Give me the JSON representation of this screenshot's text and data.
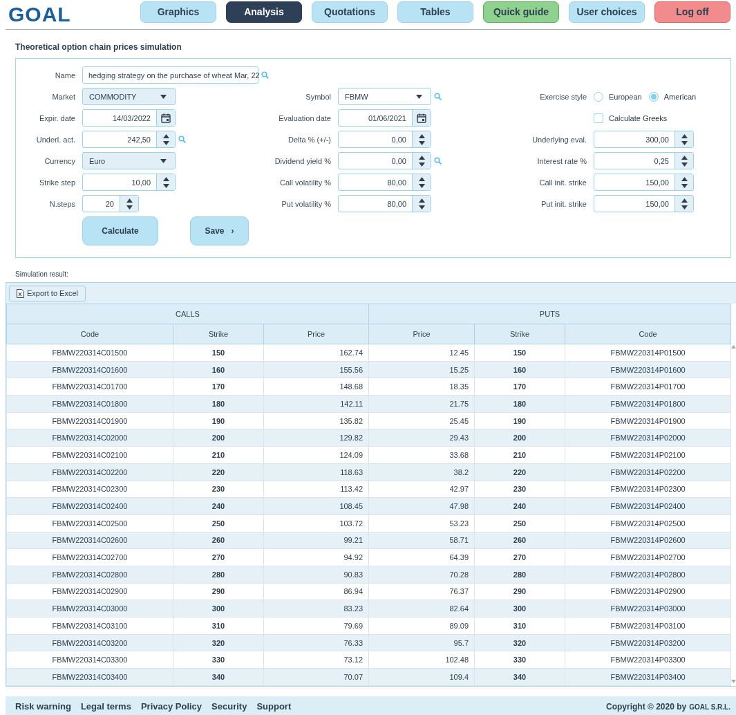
{
  "logo": "GOAL",
  "nav": [
    {
      "label": "Graphics",
      "kind": "nav",
      "selected": false
    },
    {
      "label": "Analysis",
      "kind": "nav",
      "selected": true
    },
    {
      "label": "Quotations",
      "kind": "nav",
      "selected": false
    },
    {
      "label": "Tables",
      "kind": "nav",
      "selected": false
    },
    {
      "label": "Quick guide",
      "kind": "guide",
      "selected": false
    },
    {
      "label": "User choices",
      "kind": "nav",
      "selected": false
    },
    {
      "label": "Log off",
      "kind": "logout",
      "selected": false
    }
  ],
  "page_title": "Theoretical option chain prices simulation",
  "form_rows": [
    {
      "left": {
        "label": "Name",
        "kind": "text",
        "value": "hedging strategy on the purchase of wheat Mar, 22",
        "search": true
      }
    },
    {
      "left": {
        "label": "Market",
        "kind": "select",
        "value": "COMMODITY"
      },
      "middle": {
        "label": "Symbol",
        "kind": "select",
        "value": "FBMW",
        "search": true
      },
      "right": {
        "label": "Exercise style",
        "kind": "radio",
        "options": [
          {
            "label": "European",
            "selected": false
          },
          {
            "label": "American",
            "selected": true
          }
        ]
      }
    },
    {
      "left": {
        "label": "Expir. date",
        "kind": "date",
        "value": "14/03/2022"
      },
      "middle": {
        "label": "Evaluation date",
        "kind": "date",
        "value": "01/06/2021"
      },
      "right": {
        "kind": "checkbox",
        "text": "Calculate Greeks",
        "checked": false
      }
    },
    {
      "left": {
        "label": "Underl. act.",
        "kind": "spin",
        "value": "242,50",
        "search": true
      },
      "middle": {
        "label": "Delta % (+/-)",
        "kind": "spin",
        "value": "0,00"
      },
      "right": {
        "label": "Underlying eval.",
        "kind": "spin",
        "value": "300,00"
      }
    },
    {
      "left": {
        "label": "Currency",
        "kind": "select",
        "value": "Euro"
      },
      "middle": {
        "label": "Dividend yield %",
        "kind": "spin",
        "value": "0,00",
        "search": true
      },
      "right": {
        "label": "Interest rate %",
        "kind": "spin",
        "value": "0,25"
      }
    },
    {
      "left": {
        "label": "Strike step",
        "kind": "spin",
        "value": "10,00"
      },
      "middle": {
        "label": "Call volatility %",
        "kind": "spin",
        "value": "80,00"
      },
      "right": {
        "label": "Call init. strike",
        "kind": "spin",
        "value": "150,00"
      }
    },
    {
      "left": {
        "label": "N.steps",
        "kind": "spin",
        "value": "20"
      },
      "middle": {
        "label": "Put volatility %",
        "kind": "spin",
        "value": "80,00"
      },
      "right": {
        "label": "Put init. strike",
        "kind": "spin",
        "value": "150,00"
      }
    }
  ],
  "actions": [
    {
      "label": "Calculate"
    },
    {
      "label": "Save",
      "suffix": "›"
    }
  ],
  "result_label": "Simulation result:",
  "export_button": "Export to Excel",
  "table": {
    "groups": [
      "CALLS",
      "PUTS"
    ],
    "columns": [
      "Code",
      "Strike",
      "Price",
      "Price",
      "Strike",
      "Code"
    ],
    "rows": [
      [
        "FBMW220314C01500",
        "150",
        "162.74",
        "12.45",
        "150",
        "FBMW220314P01500"
      ],
      [
        "FBMW220314C01600",
        "160",
        "155.56",
        "15.25",
        "160",
        "FBMW220314P01600"
      ],
      [
        "FBMW220314C01700",
        "170",
        "148.68",
        "18.35",
        "170",
        "FBMW220314P01700"
      ],
      [
        "FBMW220314C01800",
        "180",
        "142.11",
        "21.75",
        "180",
        "FBMW220314P01800"
      ],
      [
        "FBMW220314C01900",
        "190",
        "135.82",
        "25.45",
        "190",
        "FBMW220314P01900"
      ],
      [
        "FBMW220314C02000",
        "200",
        "129.82",
        "29.43",
        "200",
        "FBMW220314P02000"
      ],
      [
        "FBMW220314C02100",
        "210",
        "124.09",
        "33.68",
        "210",
        "FBMW220314P02100"
      ],
      [
        "FBMW220314C02200",
        "220",
        "118.63",
        "38.2",
        "220",
        "FBMW220314P02200"
      ],
      [
        "FBMW220314C02300",
        "230",
        "113.42",
        "42.97",
        "230",
        "FBMW220314P02300"
      ],
      [
        "FBMW220314C02400",
        "240",
        "108.45",
        "47.98",
        "240",
        "FBMW220314P02400"
      ],
      [
        "FBMW220314C02500",
        "250",
        "103.72",
        "53.23",
        "250",
        "FBMW220314P02500"
      ],
      [
        "FBMW220314C02600",
        "260",
        "99.21",
        "58.71",
        "260",
        "FBMW220314P02600"
      ],
      [
        "FBMW220314C02700",
        "270",
        "94.92",
        "64.39",
        "270",
        "FBMW220314P02700"
      ],
      [
        "FBMW220314C02800",
        "280",
        "90.83",
        "70.28",
        "280",
        "FBMW220314P02800"
      ],
      [
        "FBMW220314C02900",
        "290",
        "86.94",
        "76.37",
        "290",
        "FBMW220314P02900"
      ],
      [
        "FBMW220314C03000",
        "300",
        "83.23",
        "82.64",
        "300",
        "FBMW220314P03000"
      ],
      [
        "FBMW220314C03100",
        "310",
        "79.69",
        "89.09",
        "310",
        "FBMW220314P03100"
      ],
      [
        "FBMW220314C03200",
        "320",
        "76.33",
        "95.7",
        "320",
        "FBMW220314P03200"
      ],
      [
        "FBMW220314C03300",
        "330",
        "73.12",
        "102.48",
        "330",
        "FBMW220314P03300"
      ],
      [
        "FBMW220314C03400",
        "340",
        "70.07",
        "109.4",
        "340",
        "FBMW220314P03400"
      ]
    ]
  },
  "footer": {
    "links": [
      "Risk warning",
      "Legal terms",
      "Privacy Policy",
      "Security",
      "Support"
    ],
    "copyright": "Copyright © 2020 by",
    "company": "GOAL S.R.L."
  }
}
